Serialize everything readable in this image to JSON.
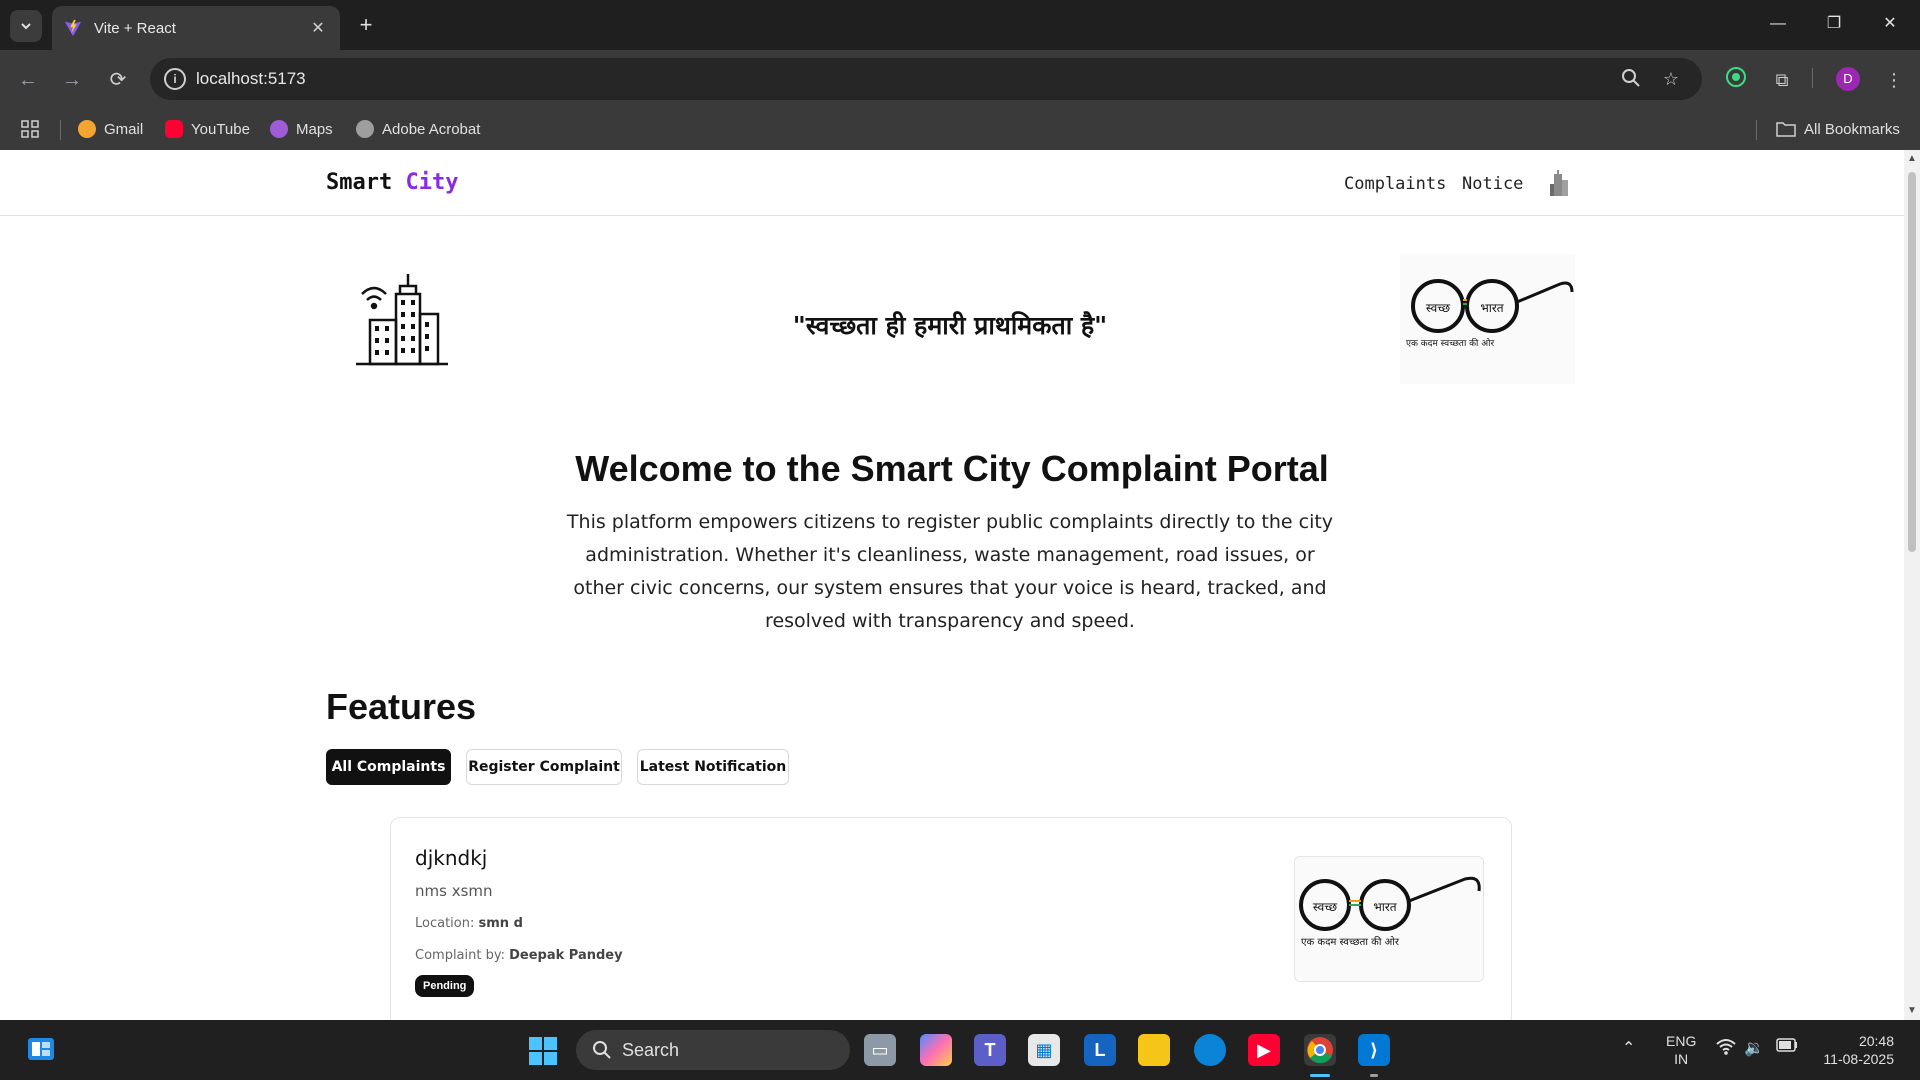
{
  "browser": {
    "tab_title": "Vite + React",
    "url": "localhost:5173",
    "bookmarks": [
      "Gmail",
      "YouTube",
      "Maps",
      "Adobe Acrobat"
    ],
    "all_bookmarks": "All Bookmarks",
    "profile_initial": "D"
  },
  "site": {
    "brand_main": "Smart",
    "brand_accent": "City",
    "nav_links": [
      "Complaints",
      "Notice"
    ],
    "hero_quote": "\"स्वच्छता ही हमारी प्राथमिकता है\"",
    "logo_word_left": "स्वच्छ",
    "logo_word_right": "भारत",
    "logo_tagline": "एक कदम स्वच्छता की ओर",
    "welcome_title": "Welcome to the Smart City Complaint Portal",
    "welcome_text": "This platform empowers citizens to register public complaints directly to the city administration. Whether it's cleanliness, waste management, road issues, or other civic concerns, our system ensures that your voice is heard, tracked, and resolved with transparency and speed.",
    "features_title": "Features",
    "feature_tabs": [
      "All Complaints",
      "Register Complaint",
      "Latest Notification"
    ]
  },
  "complaint": {
    "title": "djkndkj",
    "description": "nms xsmn",
    "location_label": "Location:",
    "location_value": "smn d",
    "by_label": "Complaint by:",
    "by_value": "Deepak Pandey",
    "status": "Pending"
  },
  "taskbar": {
    "search_label": "Search",
    "lang_line1": "ENG",
    "lang_line2": "IN",
    "time": "20:48",
    "date": "11-08-2025"
  },
  "colors": {
    "accent": "#8a2be2",
    "chrome_dark": "#1f1f1f",
    "chrome_mid": "#3a3a3a",
    "badge": "#111111"
  }
}
